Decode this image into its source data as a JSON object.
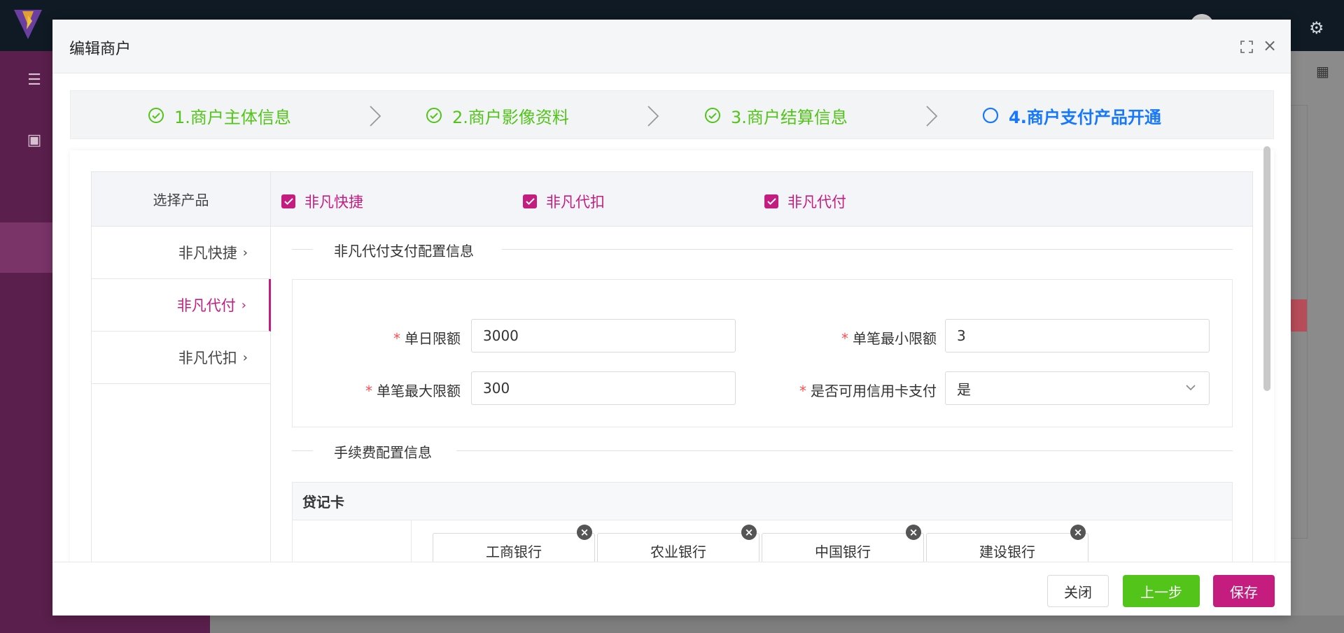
{
  "modal": {
    "title": "编辑商户",
    "steps": [
      {
        "label": "1.商户主体信息",
        "status": "done"
      },
      {
        "label": "2.商户影像资料",
        "status": "done"
      },
      {
        "label": "3.商户结算信息",
        "status": "done"
      },
      {
        "label": "4.商户支付产品开通",
        "status": "current"
      }
    ],
    "product_select": {
      "header_label": "选择产品",
      "options": [
        {
          "label": "非凡快捷",
          "checked": true
        },
        {
          "label": "非凡代扣",
          "checked": true
        },
        {
          "label": "非凡代付",
          "checked": true
        }
      ]
    },
    "side_menu": [
      {
        "label": "非凡快捷",
        "active": false
      },
      {
        "label": "非凡代付",
        "active": true
      },
      {
        "label": "非凡代扣",
        "active": false
      }
    ],
    "config_section": {
      "title": "非凡代付支付配置信息",
      "fields": {
        "daily_limit": {
          "label": "单日限额",
          "value": "3000"
        },
        "min_per_txn": {
          "label": "单笔最小限额",
          "value": "3"
        },
        "max_per_txn": {
          "label": "单笔最大限额",
          "value": "300"
        },
        "credit_card": {
          "label": "是否可用信用卡支付",
          "value": "是"
        }
      }
    },
    "fee_section": {
      "title": "手续费配置信息",
      "card_type": "贷记卡",
      "banks": [
        "工商银行",
        "农业银行",
        "中国银行",
        "建设银行"
      ]
    },
    "footer": {
      "close_label": "关闭",
      "prev_label": "上一步",
      "save_label": "保存"
    }
  },
  "colors": {
    "primary": "#c41d7f",
    "success": "#52c41a",
    "step_current": "#1677ff",
    "required": "#ff4d4f"
  }
}
